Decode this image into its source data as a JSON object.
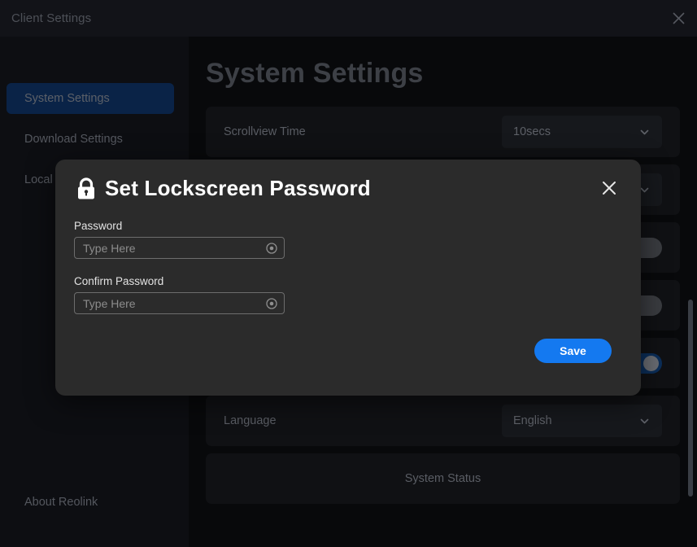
{
  "window": {
    "title": "Client Settings",
    "close_icon": "close-icon"
  },
  "sidebar": {
    "items": [
      {
        "label": "System Settings",
        "active": true
      },
      {
        "label": "Download Settings",
        "active": false
      },
      {
        "label": "Local F",
        "active": false
      }
    ],
    "bottom_item": {
      "label": "About Reolink"
    }
  },
  "main": {
    "page_title": "System Settings",
    "rows": [
      {
        "label": "Scrollview Time",
        "control": "select",
        "value": "10secs"
      },
      {
        "label": "",
        "control": "select",
        "value": ""
      },
      {
        "label": "",
        "control": "toggle",
        "state": "off"
      },
      {
        "label": "",
        "control": "toggle",
        "state": "off"
      },
      {
        "label": "",
        "control": "toggle",
        "state": "on"
      },
      {
        "label": "Language",
        "control": "select",
        "value": "English"
      },
      {
        "label": "System Status",
        "control": "none",
        "centered": true
      }
    ],
    "scrollbar": {
      "visible": true
    }
  },
  "modal": {
    "title": "Set Lockscreen Password",
    "lock_icon": "lock-icon",
    "close_icon": "close-icon",
    "fields": [
      {
        "label": "Password",
        "value": "",
        "placeholder": "Type Here",
        "clear_icon": "clear-circle-icon"
      },
      {
        "label": "Confirm Password",
        "value": "",
        "placeholder": "Type Here",
        "clear_icon": "clear-circle-icon"
      }
    ],
    "save_label": "Save"
  },
  "colors": {
    "accent_blue": "#1479f0",
    "sidebar_active": "#0a2347",
    "modal_bg": "#2b2b2b",
    "window_bg": "#0a0b0d",
    "toggle_on": "#0b2e59"
  }
}
